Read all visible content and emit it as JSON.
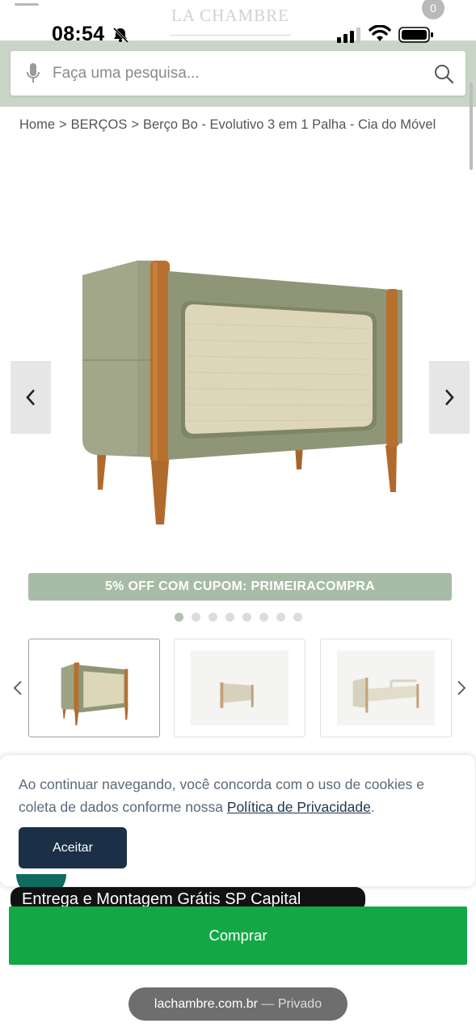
{
  "status_bar": {
    "time": "08:54",
    "icons": [
      "bell-slash-icon",
      "signal-icon",
      "wifi-icon",
      "battery-icon"
    ]
  },
  "header": {
    "logo_text": "LA CHAMBRE",
    "cart_count": "0",
    "search_placeholder": "Faça uma pesquisa..."
  },
  "breadcrumb": {
    "items": [
      "Home",
      "BERÇOS",
      "Berço Bo - Evolutivo 3 em 1 Palha - Cia do Móvel"
    ],
    "separator": ">"
  },
  "product": {
    "image_alt": "Berço Bo - Evolutivo 3 em 1 Palha",
    "promo": "5% OFF COM CUPOM: PRIMEIRACOMPRA",
    "gallery_count": 8,
    "gallery_active": 0
  },
  "cookie_banner": {
    "text": "Ao continuar navegando, você concorda com o uso de cookies e coleta de dados conforme nossa ",
    "link": "Política de Privacidade",
    "end": ".",
    "button": "Aceitar"
  },
  "delivery_text": "Entrega e Montagem Grátis SP Capital",
  "buy_button": "Comprar",
  "browser": {
    "domain": "lachambre.com.br",
    "mode": " — Privado"
  },
  "colors": {
    "header_green": "#c9d6c7",
    "promo_green": "#a8bba6",
    "buy_green": "#13a846",
    "accept_navy": "#1b3047"
  }
}
